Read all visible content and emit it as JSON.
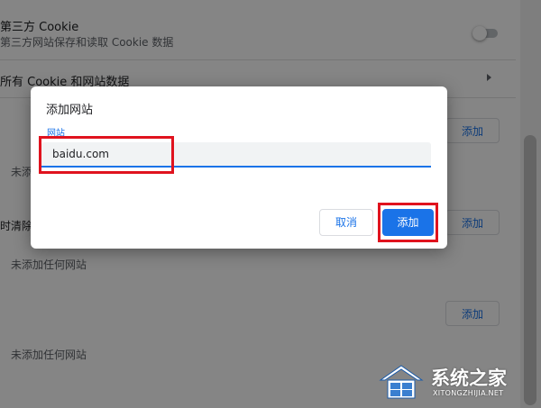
{
  "settings": {
    "third_party_cookie": {
      "title": "第三方 Cookie",
      "description": "第三方网站保存和读取 Cookie 数据",
      "toggle_on": false
    },
    "all_cookies_row": "所有 Cookie 和网站数据",
    "sections": [
      {
        "label": "",
        "add_label": "添加",
        "empty_text": "未添"
      },
      {
        "label": "时清除",
        "add_label": "添加",
        "empty_text": "未添加任何网站"
      },
      {
        "label": "",
        "add_label": "添加",
        "empty_text": "未添加任何网站"
      }
    ]
  },
  "dialog": {
    "title": "添加网站",
    "field_label": "网站",
    "input_value": "baidu.com",
    "cancel_label": "取消",
    "add_label": "添加"
  },
  "watermark": {
    "cn": "系统之家",
    "en": "XITONGZHIJIA.NET"
  },
  "colors": {
    "accent": "#1a73e8",
    "highlight": "#e0131e"
  }
}
